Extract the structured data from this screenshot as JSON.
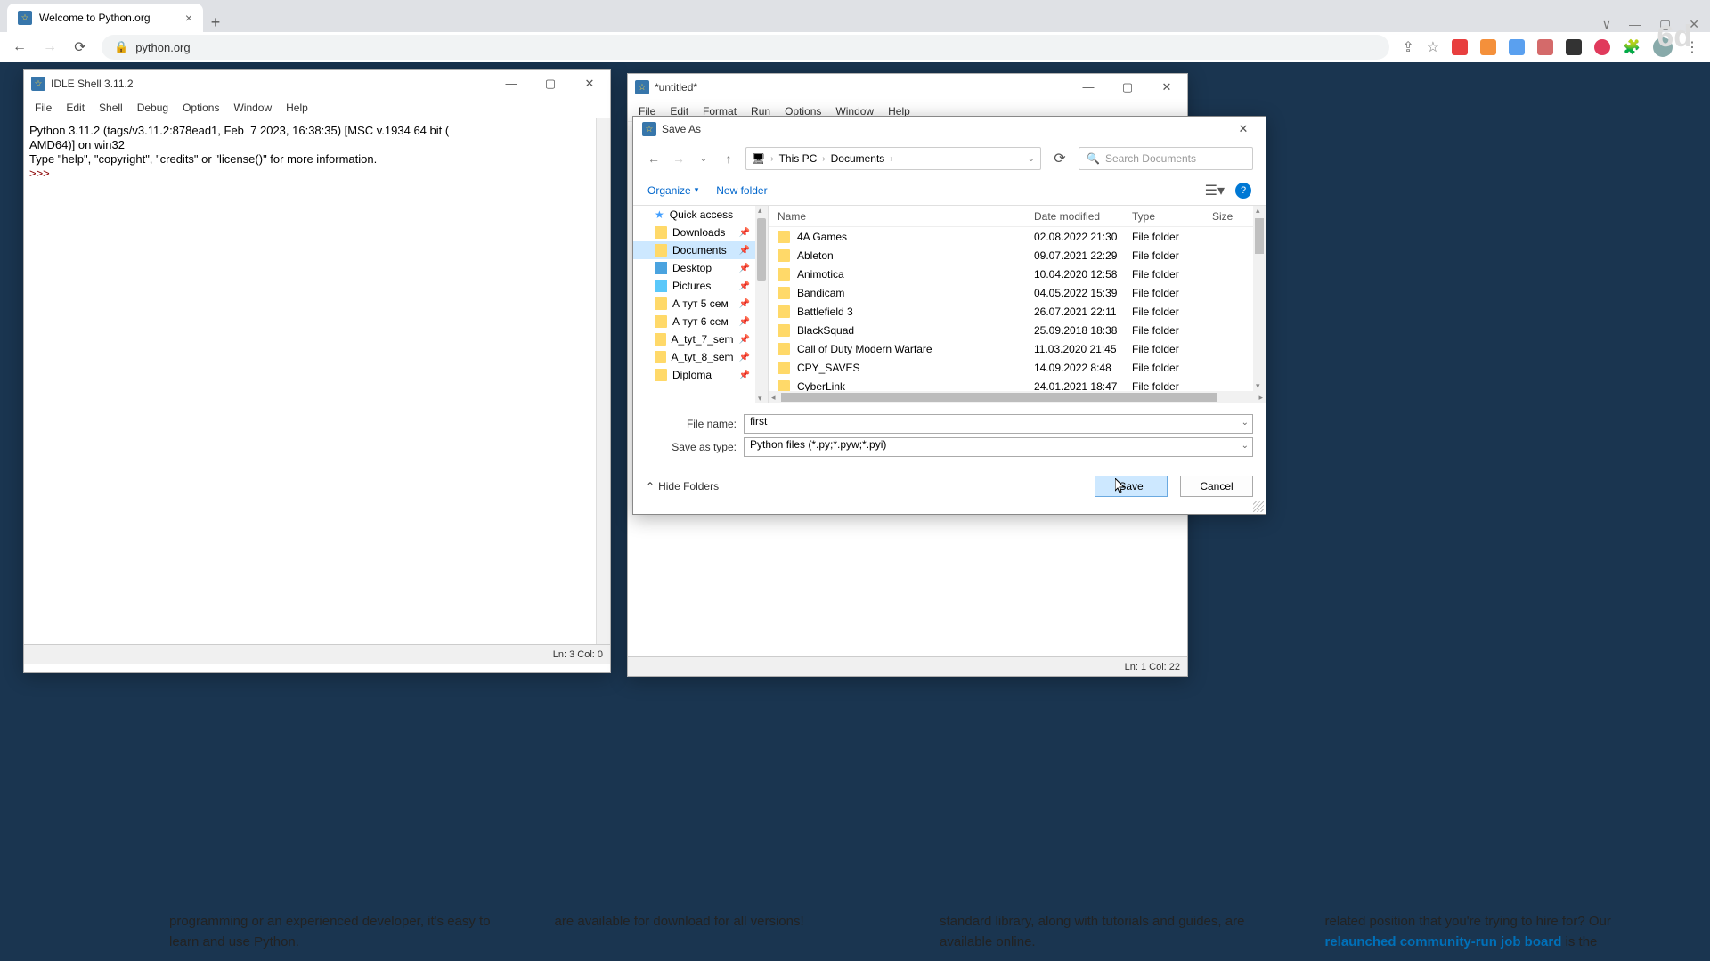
{
  "browser": {
    "tab_title": "Welcome to Python.org",
    "url": "python.org",
    "lock_icon": "🔒"
  },
  "watermark": "6d",
  "idle": {
    "title": "IDLE Shell 3.11.2",
    "menu": [
      "File",
      "Edit",
      "Shell",
      "Debug",
      "Options",
      "Window",
      "Help"
    ],
    "banner_line1": "Python 3.11.2 (tags/v3.11.2:878ead1, Feb  7 2023, 16:38:35) [MSC v.1934 64 bit (",
    "banner_line2": "AMD64)] on win32",
    "banner_line3": "Type \"help\", \"copyright\", \"credits\" or \"license()\" for more information.",
    "prompt": ">>>",
    "status": "Ln: 3  Col: 0"
  },
  "editor": {
    "title": "*untitled*",
    "menu": [
      "File",
      "Edit",
      "Format",
      "Run",
      "Options",
      "Window",
      "Help"
    ],
    "status": "Ln: 1  Col: 22"
  },
  "saveas": {
    "title": "Save As",
    "breadcrumb": {
      "root": "This PC",
      "current": "Documents"
    },
    "search_placeholder": "Search Documents",
    "organize": "Organize",
    "new_folder": "New folder",
    "tree": [
      {
        "label": "Quick access",
        "icon": "star"
      },
      {
        "label": "Downloads",
        "icon": "folder",
        "pin": true
      },
      {
        "label": "Documents",
        "icon": "folder",
        "pin": true,
        "selected": true
      },
      {
        "label": "Desktop",
        "icon": "blue",
        "pin": true
      },
      {
        "label": "Pictures",
        "icon": "pic",
        "pin": true
      },
      {
        "label": "А тут 5 сем",
        "icon": "folder",
        "pin": true
      },
      {
        "label": "А тут 6 сем",
        "icon": "folder",
        "pin": true
      },
      {
        "label": "A_tyt_7_sem",
        "icon": "folder",
        "pin": true
      },
      {
        "label": "A_tyt_8_sem",
        "icon": "folder",
        "pin": true
      },
      {
        "label": "Diploma",
        "icon": "folder",
        "pin": true
      }
    ],
    "cols": {
      "name": "Name",
      "date": "Date modified",
      "type": "Type",
      "size": "Size"
    },
    "files": [
      {
        "name": "4A Games",
        "date": "02.08.2022 21:30",
        "type": "File folder"
      },
      {
        "name": "Ableton",
        "date": "09.07.2021 22:29",
        "type": "File folder"
      },
      {
        "name": "Animotica",
        "date": "10.04.2020 12:58",
        "type": "File folder"
      },
      {
        "name": "Bandicam",
        "date": "04.05.2022 15:39",
        "type": "File folder"
      },
      {
        "name": "Battlefield 3",
        "date": "26.07.2021 22:11",
        "type": "File folder"
      },
      {
        "name": "BlackSquad",
        "date": "25.09.2018 18:38",
        "type": "File folder"
      },
      {
        "name": "Call of Duty Modern Warfare",
        "date": "11.03.2020 21:45",
        "type": "File folder"
      },
      {
        "name": "CPY_SAVES",
        "date": "14.09.2022 8:48",
        "type": "File folder"
      },
      {
        "name": "CyberLink",
        "date": "24.01.2021 18:47",
        "type": "File folder"
      }
    ],
    "filename_label": "File name:",
    "filename_value": "first",
    "filetype_label": "Save as type:",
    "filetype_value": "Python files (*.py;*.pyw;*.pyi)",
    "hide_folders": "Hide Folders",
    "save": "Save",
    "cancel": "Cancel"
  },
  "page_content": {
    "col1": "programming or an experienced developer, it's easy to learn and use Python.",
    "col2": "are available for download for all versions!",
    "col3": "standard library, along with tutorials and guides, are available online.",
    "col4a": "related position that you're trying to hire for? Our ",
    "col4b": "relaunched community-run job board",
    "col4c": " is the"
  }
}
